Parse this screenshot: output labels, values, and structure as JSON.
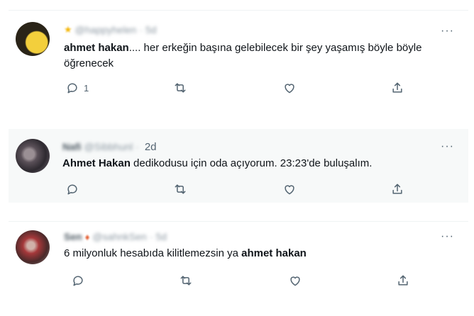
{
  "tweets": [
    {
      "display_name": "@happyhelen",
      "time": "5d",
      "text_bold": "ahmet hakan",
      "text_rest": ".... her erkeğin başına gelebilecek bir şey yaşamış böyle böyle öğrenecek",
      "reply_count": "1"
    },
    {
      "display_name": "Nafi",
      "handle": "@Sibbhunl",
      "time": "2d",
      "text_bold": "Ahmet Hakan",
      "text_rest": " dedikodusu için oda açıyorum. 23:23'de buluşalım.",
      "reply_count": ""
    },
    {
      "display_name": "Sen",
      "handle": "@sahnkSen",
      "time": "5d",
      "text_prefix": "6 milyonluk hesabıda kilitlemezsin ya ",
      "text_bold": "ahmet hakan",
      "reply_count": ""
    }
  ],
  "icons": {
    "more": "more-dots-icon",
    "reply": "reply-bubble-icon",
    "retweet": "retweet-icon",
    "like": "heart-icon",
    "share": "share-upload-icon"
  },
  "colors": {
    "text": "#0f1419",
    "muted": "#536471",
    "highlight_bg": "#f7f9f9"
  }
}
